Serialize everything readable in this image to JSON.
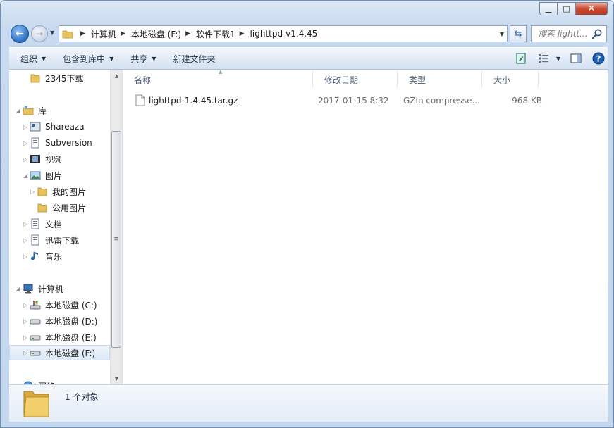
{
  "window": {
    "controls": {
      "min": "▁",
      "max": "□",
      "close": "✕"
    }
  },
  "nav": {
    "back_glyph": "←",
    "forward_glyph": "→",
    "breadcrumbs": [
      "计算机",
      "本地磁盘 (F:)",
      "软件下载1",
      "lighttpd-v1.4.45"
    ],
    "search_placeholder": "搜索 lightt..."
  },
  "toolbar": {
    "organize": "组织",
    "include_in_library": "包含到库中",
    "share": "共享",
    "new_folder": "新建文件夹"
  },
  "sidebar": {
    "items": [
      {
        "label": "2345下载",
        "icon": "folder-icon"
      },
      {
        "label": "库",
        "icon": "library-icon"
      },
      {
        "label": "Shareaza",
        "icon": "shareaza-icon"
      },
      {
        "label": "Subversion",
        "icon": "document-library-icon"
      },
      {
        "label": "视频",
        "icon": "video-icon"
      },
      {
        "label": "图片",
        "icon": "pictures-icon"
      },
      {
        "label": "我的图片",
        "icon": "folder-icon"
      },
      {
        "label": "公用图片",
        "icon": "folder-icon"
      },
      {
        "label": "文档",
        "icon": "documents-icon"
      },
      {
        "label": "迅雷下载",
        "icon": "document-library-icon"
      },
      {
        "label": "音乐",
        "icon": "music-icon"
      },
      {
        "label": "计算机",
        "icon": "computer-icon"
      },
      {
        "label": "本地磁盘 (C:)",
        "icon": "system-drive-icon"
      },
      {
        "label": "本地磁盘 (D:)",
        "icon": "drive-icon"
      },
      {
        "label": "本地磁盘 (E:)",
        "icon": "drive-icon"
      },
      {
        "label": "本地磁盘 (F:)",
        "icon": "drive-icon",
        "selected": true
      },
      {
        "label": "网络",
        "icon": "network-icon"
      }
    ]
  },
  "columns": {
    "name": "名称",
    "modified": "修改日期",
    "type": "类型",
    "size": "大小"
  },
  "files": [
    {
      "name": "lighttpd-1.4.45.tar.gz",
      "modified": "2017-01-15 8:32",
      "type": "GZip compresse...",
      "size": "968 KB"
    }
  ],
  "details": {
    "count": "1 个对象"
  },
  "colors": {
    "accent": "#2b6fc4",
    "folder": "#e8c25a",
    "selection": "#dde9f6"
  }
}
